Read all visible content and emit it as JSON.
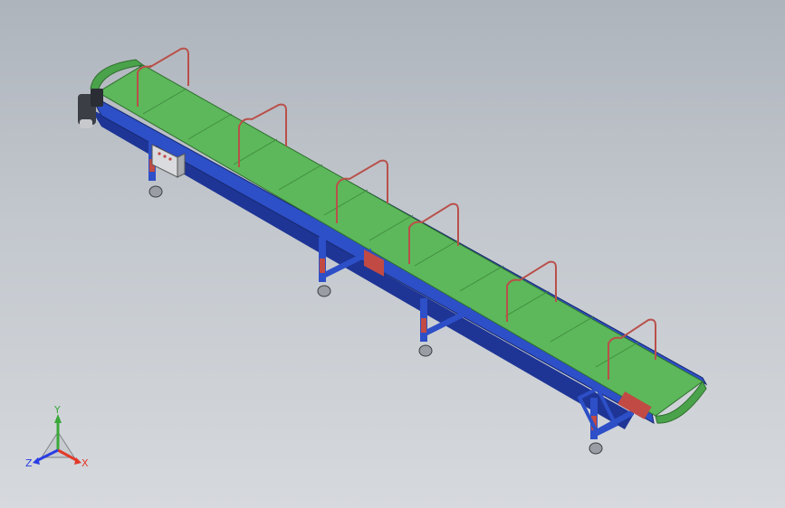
{
  "triad": {
    "y_label": "Y",
    "x_label": "X",
    "z_label": "Z"
  },
  "colors": {
    "belt": "#5cb85a",
    "belt_line": "#3f8a3e",
    "frame": "#2d4fc7",
    "frame_dark": "#1c3492",
    "rail": "#b9504a",
    "leg_red": "#c24a44",
    "axis_x": "#e23a2a",
    "axis_y": "#3aa83a",
    "axis_z": "#2a3ee2"
  },
  "icons": {
    "triad": "view-orientation-triad-icon",
    "motor": "gear-motor-icon",
    "control_box": "control-box-icon",
    "caster": "caster-wheel-icon"
  }
}
